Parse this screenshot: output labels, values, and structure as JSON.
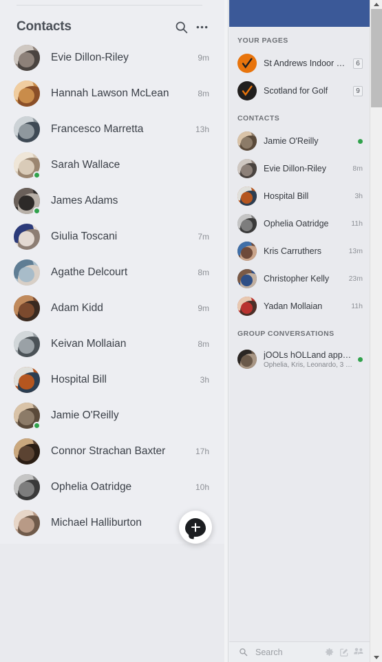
{
  "left": {
    "title": "Contacts",
    "icons": {
      "search": "search-icon",
      "more": "more-options-icon"
    },
    "contacts": [
      {
        "name": "Evie Dillon-Riley",
        "time": "9m",
        "online": false,
        "c1": "#8d8179",
        "c2": "#cfc8c2",
        "c3": "#4a4440"
      },
      {
        "name": "Hannah Lawson McLean",
        "time": "8m",
        "online": false,
        "c1": "#c98c4a",
        "c2": "#f0cda0",
        "c3": "#8a4f28"
      },
      {
        "name": "Francesco Marretta",
        "time": "13h",
        "online": false,
        "c1": "#8f989e",
        "c2": "#cdd3d7",
        "c3": "#3f4a55"
      },
      {
        "name": "Sarah Wallace",
        "time": "",
        "online": true,
        "c1": "#d9cbb8",
        "c2": "#efe6d8",
        "c3": "#9b8670"
      },
      {
        "name": "James Adams",
        "time": "",
        "online": true,
        "c1": "#2d2a28",
        "c2": "#6a605a",
        "c3": "#b8b0a8"
      },
      {
        "name": "Giulia Toscani",
        "time": "7m",
        "online": false,
        "c1": "#e3d9d2",
        "c2": "#2b3a7a",
        "c3": "#8d7e74"
      },
      {
        "name": "Agathe Delcourt",
        "time": "8m",
        "online": false,
        "c1": "#a8bcc9",
        "c2": "#5f7d94",
        "c3": "#d8cfc6"
      },
      {
        "name": "Adam Kidd",
        "time": "9m",
        "online": false,
        "c1": "#7b4a2e",
        "c2": "#c08a5c",
        "c3": "#3a2a20"
      },
      {
        "name": "Keivan Mollaian",
        "time": "8m",
        "online": false,
        "c1": "#9aa1a6",
        "c2": "#d2d7da",
        "c3": "#4b5257"
      },
      {
        "name": "Hospital Bill",
        "time": "3h",
        "online": false,
        "c1": "#b5561f",
        "c2": "#e0e0dc",
        "c3": "#2b3e52"
      },
      {
        "name": "Jamie O'Reilly",
        "time": "",
        "online": true,
        "c1": "#8c7b68",
        "c2": "#d9c3a8",
        "c3": "#5a4a3a"
      },
      {
        "name": "Connor Strachan Baxter",
        "time": "17h",
        "online": false,
        "c1": "#5b4332",
        "c2": "#caa87e",
        "c3": "#2a1d14"
      },
      {
        "name": "Ophelia Oatridge",
        "time": "10h",
        "online": false,
        "c1": "#7d7d7d",
        "c2": "#c5c5c5",
        "c3": "#3a3a3a"
      },
      {
        "name": "Michael Halliburton",
        "time": "",
        "online": false,
        "c1": "#b89a86",
        "c2": "#e7d6c8",
        "c3": "#6f5a4a"
      },
      {
        "name": "",
        "time": "",
        "online": false,
        "c1": "#e4b89a",
        "c2": "#f0d4bc",
        "c3": "#b08a6c"
      }
    ],
    "fab": {
      "label": "new-message"
    }
  },
  "right": {
    "sections": {
      "pages_title": "YOUR PAGES",
      "contacts_title": "CONTACTS",
      "groups_title": "GROUP CONVERSATIONS"
    },
    "pages": [
      {
        "name": "St Andrews Indoor Go…",
        "badge": "6",
        "bg": "#e8740c",
        "tick": "#1c1e21"
      },
      {
        "name": "Scotland for Golf",
        "badge": "9",
        "bg": "#211f1e",
        "tick": "#e8740c"
      }
    ],
    "contacts": [
      {
        "name": "Jamie O'Reilly",
        "time": "",
        "online": true,
        "c1": "#8c7b68",
        "c2": "#d9c3a8",
        "c3": "#5a4a3a"
      },
      {
        "name": "Evie Dillon-Riley",
        "time": "8m",
        "online": false,
        "c1": "#8d8179",
        "c2": "#cfc8c2",
        "c3": "#4a4440"
      },
      {
        "name": "Hospital Bill",
        "time": "3h",
        "online": false,
        "c1": "#b5561f",
        "c2": "#e0e0dc",
        "c3": "#2b3e52"
      },
      {
        "name": "Ophelia Oatridge",
        "time": "11h",
        "online": false,
        "c1": "#7d7d7d",
        "c2": "#c5c5c5",
        "c3": "#3a3a3a"
      },
      {
        "name": "Kris Carruthers",
        "time": "13m",
        "online": false,
        "c1": "#6e4a3a",
        "c2": "#3f6fa8",
        "c3": "#c9a48a"
      },
      {
        "name": "Christopher Kelly",
        "time": "23m",
        "online": false,
        "c1": "#2f4f86",
        "c2": "#7b5a46",
        "c3": "#c2b0a0"
      },
      {
        "name": "Yadan Mollaian",
        "time": "11h",
        "online": false,
        "c1": "#b8322e",
        "c2": "#e8c8b0",
        "c3": "#4a3028"
      }
    ],
    "groups": [
      {
        "title": "jOOLs hOLLand appr…",
        "subtitle": "Ophelia, Kris, Leonardo, 3 …",
        "online": true,
        "c1": "#6b5a4a",
        "c2": "#2b2724",
        "c3": "#a89684"
      }
    ],
    "bottom": {
      "search_placeholder": "Search",
      "icons": {
        "search": "search-icon",
        "settings": "gear-icon",
        "compose": "compose-icon",
        "add_people": "add-people-icon"
      }
    }
  },
  "scrollbar": {
    "up": "scroll-up-arrow",
    "down": "scroll-down-arrow"
  },
  "colors": {
    "brand_blue": "#3b5998",
    "online_green": "#31a24c",
    "page_orange": "#e8740c"
  }
}
